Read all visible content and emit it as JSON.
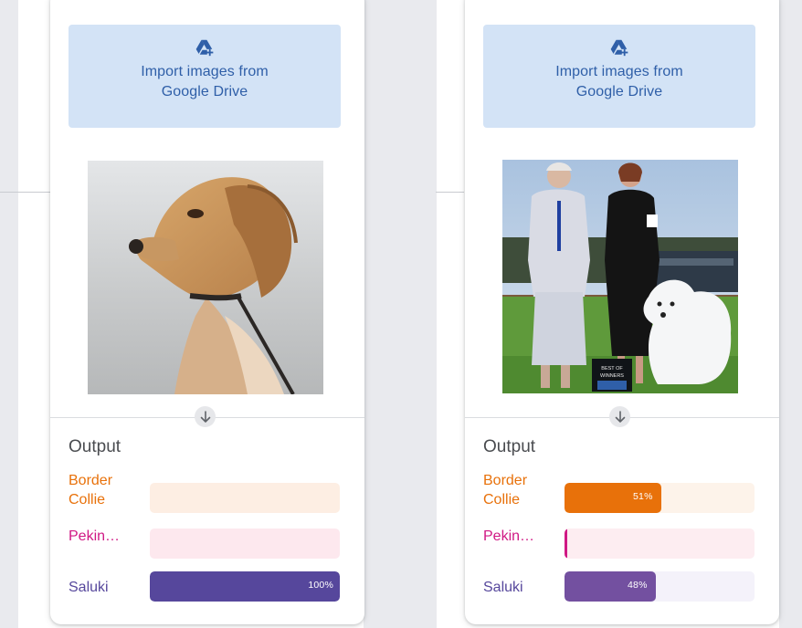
{
  "panels": [
    {
      "import_button": {
        "label": "Import images from Google Drive",
        "icon": "google-drive-add-icon"
      },
      "image": {
        "subject": "tan saluki dog portrait"
      },
      "output": {
        "title": "Output",
        "results": [
          {
            "label": "Border Collie",
            "value": 0,
            "percent_text": "",
            "color": "#e8710a",
            "track_color": "#fdeee3"
          },
          {
            "label": "Pekin…",
            "value": 0,
            "percent_text": "",
            "color": "#d01884",
            "track_color": "#fde8ee"
          },
          {
            "label": "Saluki",
            "value": 1.0,
            "percent_text": "100%",
            "color": "#56479c",
            "track_color": "#f3f2fa"
          }
        ]
      }
    },
    {
      "import_button": {
        "label": "Import images from Google Drive",
        "icon": "google-drive-add-icon"
      },
      "image": {
        "subject": "two women with white samoyed dog at dog show",
        "sign_text": "BEST OF WINNERS"
      },
      "output": {
        "title": "Output",
        "results": [
          {
            "label": "Border Collie",
            "value": 0.51,
            "percent_text": "51%",
            "color": "#e8710a",
            "track_color": "#fdf3ea"
          },
          {
            "label": "Pekin…",
            "value": 0.01,
            "percent_text": "",
            "color": "#d01884",
            "track_color": "#fdedf1"
          },
          {
            "label": "Saluki",
            "value": 0.48,
            "percent_text": "48%",
            "color": "#7350a0",
            "track_color": "#f4f2fa"
          }
        ]
      }
    }
  ],
  "colors": {
    "page_background": "#e9eaee",
    "card_background": "#ffffff",
    "import_button_background": "#d3e3f6",
    "import_button_text": "#2f5fa8",
    "border_collie_label": "#e8710a",
    "pekin_label": "#d01884",
    "saluki_label": "#56479c"
  }
}
